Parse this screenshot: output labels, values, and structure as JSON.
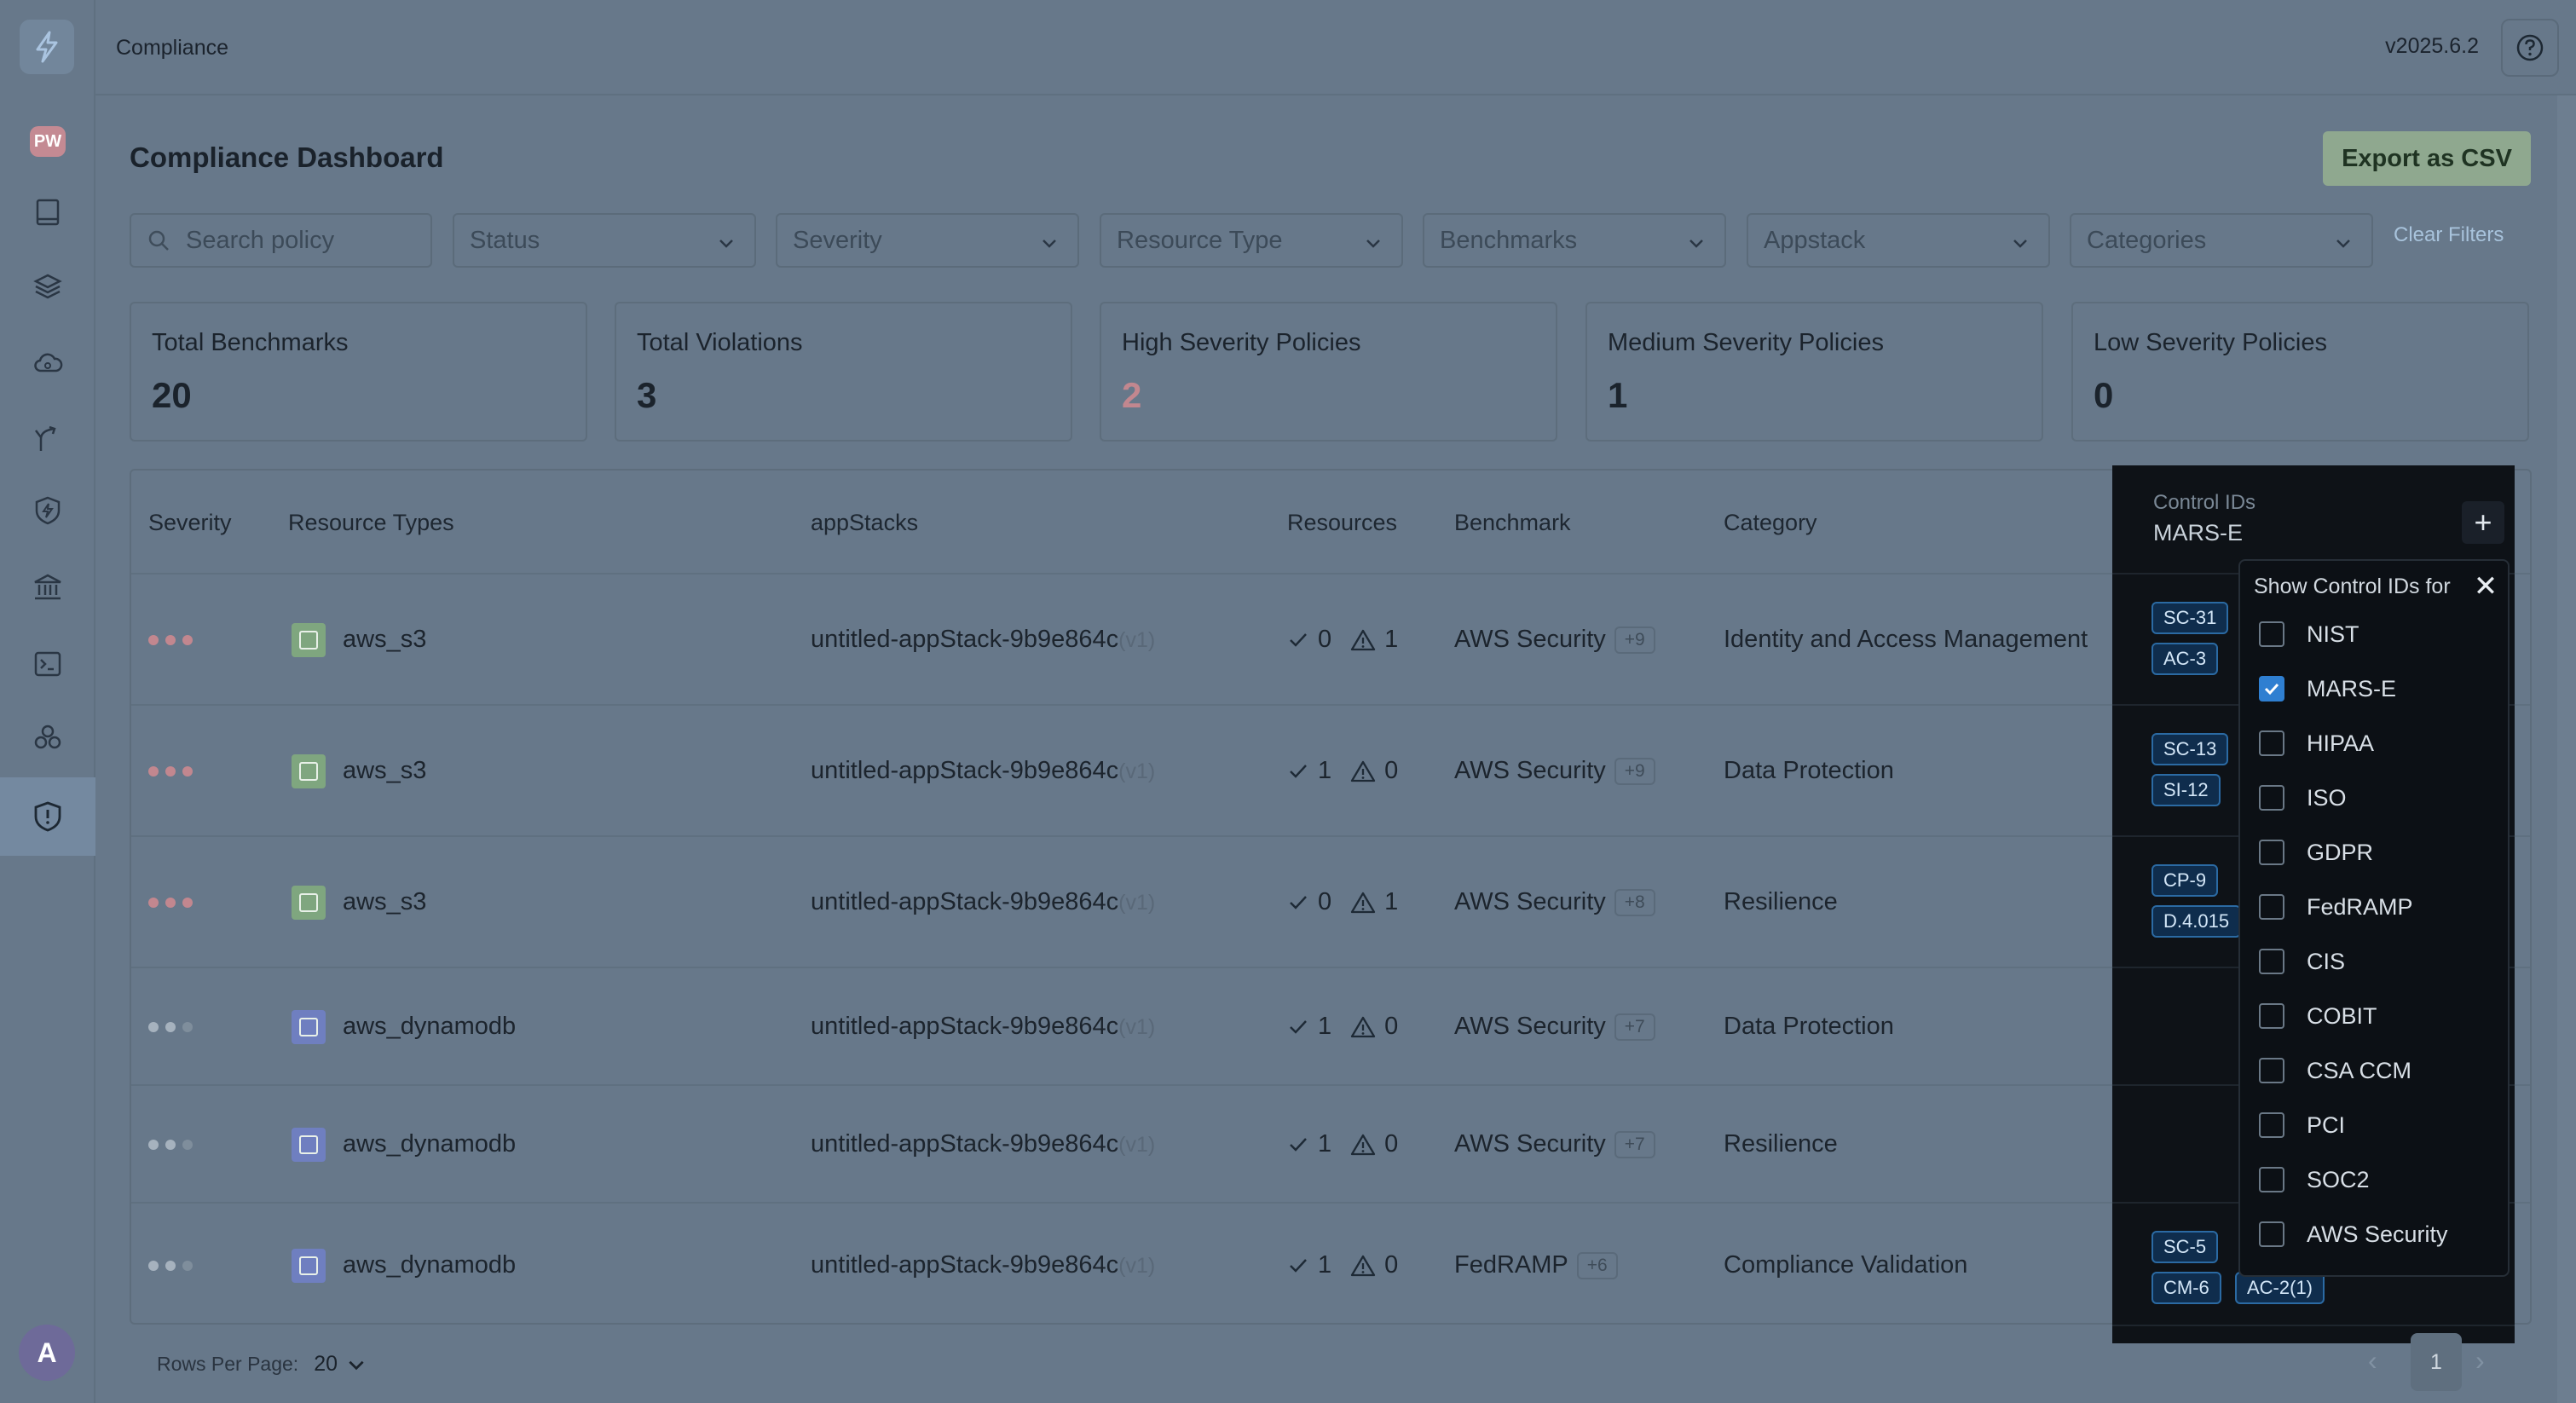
{
  "header": {
    "breadcrumb": "Compliance",
    "version": "v2025.6.2"
  },
  "sidebar": {
    "badge": "PW",
    "avatar": "A",
    "icons": [
      "book-icon",
      "layers-icon",
      "cloud-icon",
      "fork-icon",
      "shield-bolt-icon",
      "bank-icon",
      "terminal-icon",
      "cluster-icon",
      "shield-alert-icon"
    ]
  },
  "page": {
    "title": "Compliance Dashboard",
    "export_label": "Export as CSV"
  },
  "filters": {
    "search_placeholder": "Search policy",
    "status": "Status",
    "severity": "Severity",
    "resource_type": "Resource Type",
    "benchmarks": "Benchmarks",
    "appstack": "Appstack",
    "categories": "Categories",
    "clear": "Clear Filters"
  },
  "cards": [
    {
      "label": "Total Benchmarks",
      "value": "20",
      "color": "#1b232c"
    },
    {
      "label": "Total Violations",
      "value": "3",
      "color": "#1b232c"
    },
    {
      "label": "High Severity Policies",
      "value": "2",
      "color": "#c2878f"
    },
    {
      "label": "Medium Severity Policies",
      "value": "1",
      "color": "#1b232c"
    },
    {
      "label": "Low Severity Policies",
      "value": "0",
      "color": "#1b232c"
    }
  ],
  "table": {
    "headers": {
      "severity": "Severity",
      "resource_types": "Resource Types",
      "appstacks": "appStacks",
      "resources": "Resources",
      "benchmark": "Benchmark",
      "category": "Category"
    },
    "rows": [
      {
        "resource": "aws_s3",
        "appstack": "untitled-appStack-9b9e864c",
        "version": "(v1)",
        "pass": "0",
        "fail": "1",
        "benchmark": "AWS Security",
        "more": "+9",
        "category": "Identity and Access Management"
      },
      {
        "resource": "aws_s3",
        "appstack": "untitled-appStack-9b9e864c",
        "version": "(v1)",
        "pass": "1",
        "fail": "0",
        "benchmark": "AWS Security",
        "more": "+9",
        "category": "Data Protection"
      },
      {
        "resource": "aws_s3",
        "appstack": "untitled-appStack-9b9e864c",
        "version": "(v1)",
        "pass": "0",
        "fail": "1",
        "benchmark": "AWS Security",
        "more": "+8",
        "category": "Resilience"
      },
      {
        "resource": "aws_dynamodb",
        "appstack": "untitled-appStack-9b9e864c",
        "version": "(v1)",
        "pass": "1",
        "fail": "0",
        "benchmark": "AWS Security",
        "more": "+7",
        "category": "Data Protection"
      },
      {
        "resource": "aws_dynamodb",
        "appstack": "untitled-appStack-9b9e864c",
        "version": "(v1)",
        "pass": "1",
        "fail": "0",
        "benchmark": "AWS Security",
        "more": "+7",
        "category": "Resilience"
      },
      {
        "resource": "aws_dynamodb",
        "appstack": "untitled-appStack-9b9e864c",
        "version": "(v1)",
        "pass": "1",
        "fail": "0",
        "benchmark": "FedRAMP",
        "more": "+6",
        "category": "Compliance Validation"
      }
    ]
  },
  "control_panel": {
    "label": "Control IDs",
    "value": "MARS-E",
    "chips": [
      "SC-31",
      "AC-3",
      "SC-13",
      "SI-12",
      "CP-9",
      "D.4.015",
      "SC-5",
      "CM-6",
      "AC-2(1)"
    ]
  },
  "dropdown": {
    "title": "Show Control IDs for",
    "options": [
      {
        "label": "NIST",
        "checked": false
      },
      {
        "label": "MARS-E",
        "checked": true
      },
      {
        "label": "HIPAA",
        "checked": false
      },
      {
        "label": "ISO",
        "checked": false
      },
      {
        "label": "GDPR",
        "checked": false
      },
      {
        "label": "FedRAMP",
        "checked": false
      },
      {
        "label": "CIS",
        "checked": false
      },
      {
        "label": "COBIT",
        "checked": false
      },
      {
        "label": "CSA CCM",
        "checked": false
      },
      {
        "label": "PCI",
        "checked": false
      },
      {
        "label": "SOC2",
        "checked": false
      },
      {
        "label": "AWS Security",
        "checked": false
      }
    ]
  },
  "footer": {
    "rows_label": "Rows Per Page:",
    "rows_value": "20",
    "page": "1"
  },
  "colors": {
    "high": "#c2878f",
    "medium_dim": "#8898aa",
    "s3": "#7fa67f",
    "dynamodb": "#6f7fc0"
  }
}
